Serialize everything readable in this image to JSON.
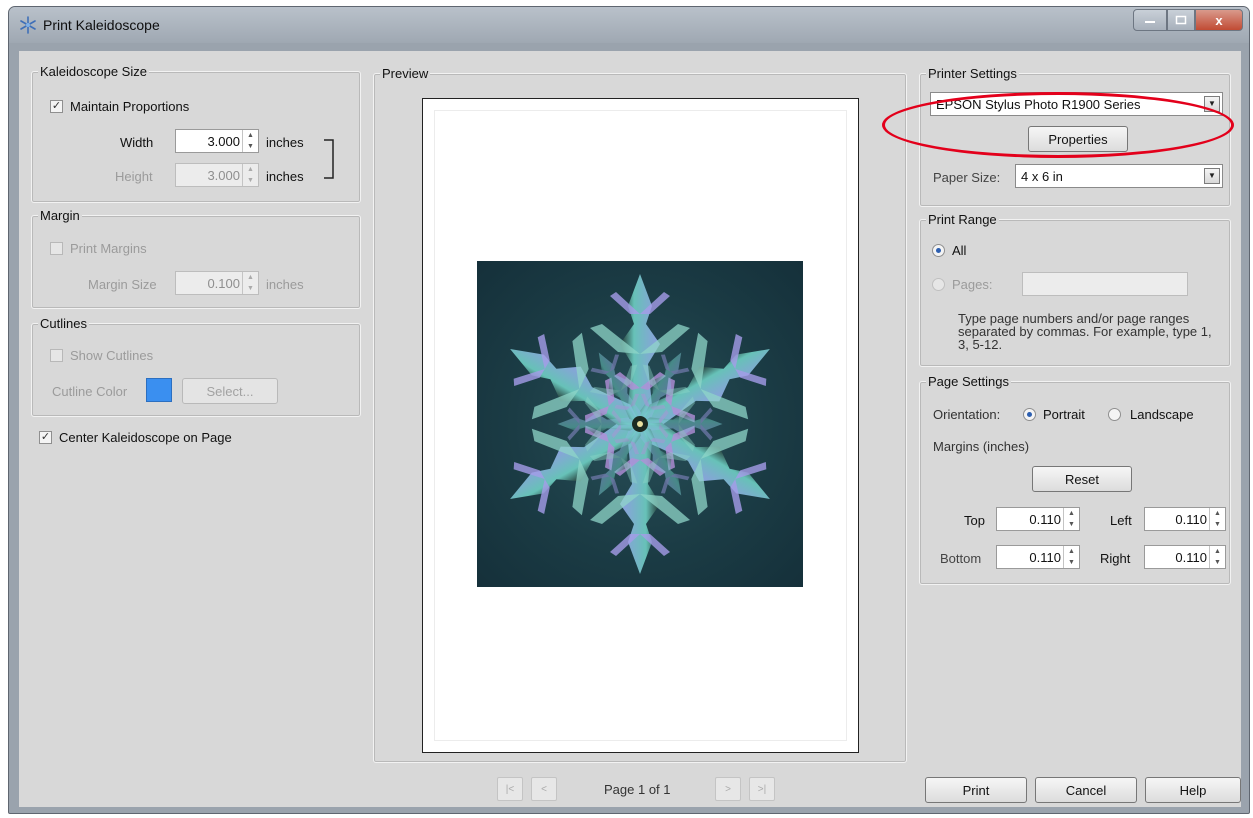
{
  "window": {
    "title": "Print Kaleidoscope",
    "close_glyph": "x"
  },
  "kaleidoscope_size": {
    "group_label": "Kaleidoscope Size",
    "maintain_label": "Maintain Proportions",
    "maintain_checked": true,
    "width_label": "Width",
    "width_value": "3.000",
    "width_unit": "inches",
    "height_label": "Height",
    "height_value": "3.000",
    "height_unit": "inches"
  },
  "margin": {
    "group_label": "Margin",
    "print_margins_label": "Print Margins",
    "print_margins_checked": false,
    "size_label": "Margin Size",
    "size_value": "0.100",
    "size_unit": "inches"
  },
  "cutlines": {
    "group_label": "Cutlines",
    "show_label": "Show Cutlines",
    "show_checked": false,
    "color_label": "Cutline Color",
    "color": "#3a8ff0",
    "select_label": "Select..."
  },
  "center_label": "Center Kaleidoscope on Page",
  "center_checked": true,
  "preview": {
    "group_label": "Preview",
    "page_label": "Page 1 of 1",
    "first_glyph": "|<",
    "prev_glyph": "<",
    "next_glyph": ">",
    "last_glyph": ">|"
  },
  "printer_settings": {
    "group_label": "Printer Settings",
    "printer": "EPSON Stylus Photo R1900 Series",
    "properties_label": "Properties",
    "paper_size_label": "Paper Size:",
    "paper_size": "4 x 6 in",
    "highlight_color": "#e3001b"
  },
  "print_range": {
    "group_label": "Print Range",
    "all_label": "All",
    "pages_label": "Pages:",
    "hint": "Type page numbers and/or page ranges separated by commas.  For example, type 1, 3, 5-12."
  },
  "page_settings": {
    "group_label": "Page Settings",
    "orientation_label": "Orientation:",
    "portrait_label": "Portrait",
    "landscape_label": "Landscape",
    "orientation": "Portrait",
    "margins_label": "Margins (inches)",
    "reset_label": "Reset",
    "top_label": "Top",
    "top_value": "0.110",
    "left_label": "Left",
    "left_value": "0.110",
    "bottom_label": "Bottom",
    "bottom_value": "0.110",
    "right_label": "Right",
    "right_value": "0.110"
  },
  "footer": {
    "print_label": "Print",
    "cancel_label": "Cancel",
    "help_label": "Help"
  }
}
